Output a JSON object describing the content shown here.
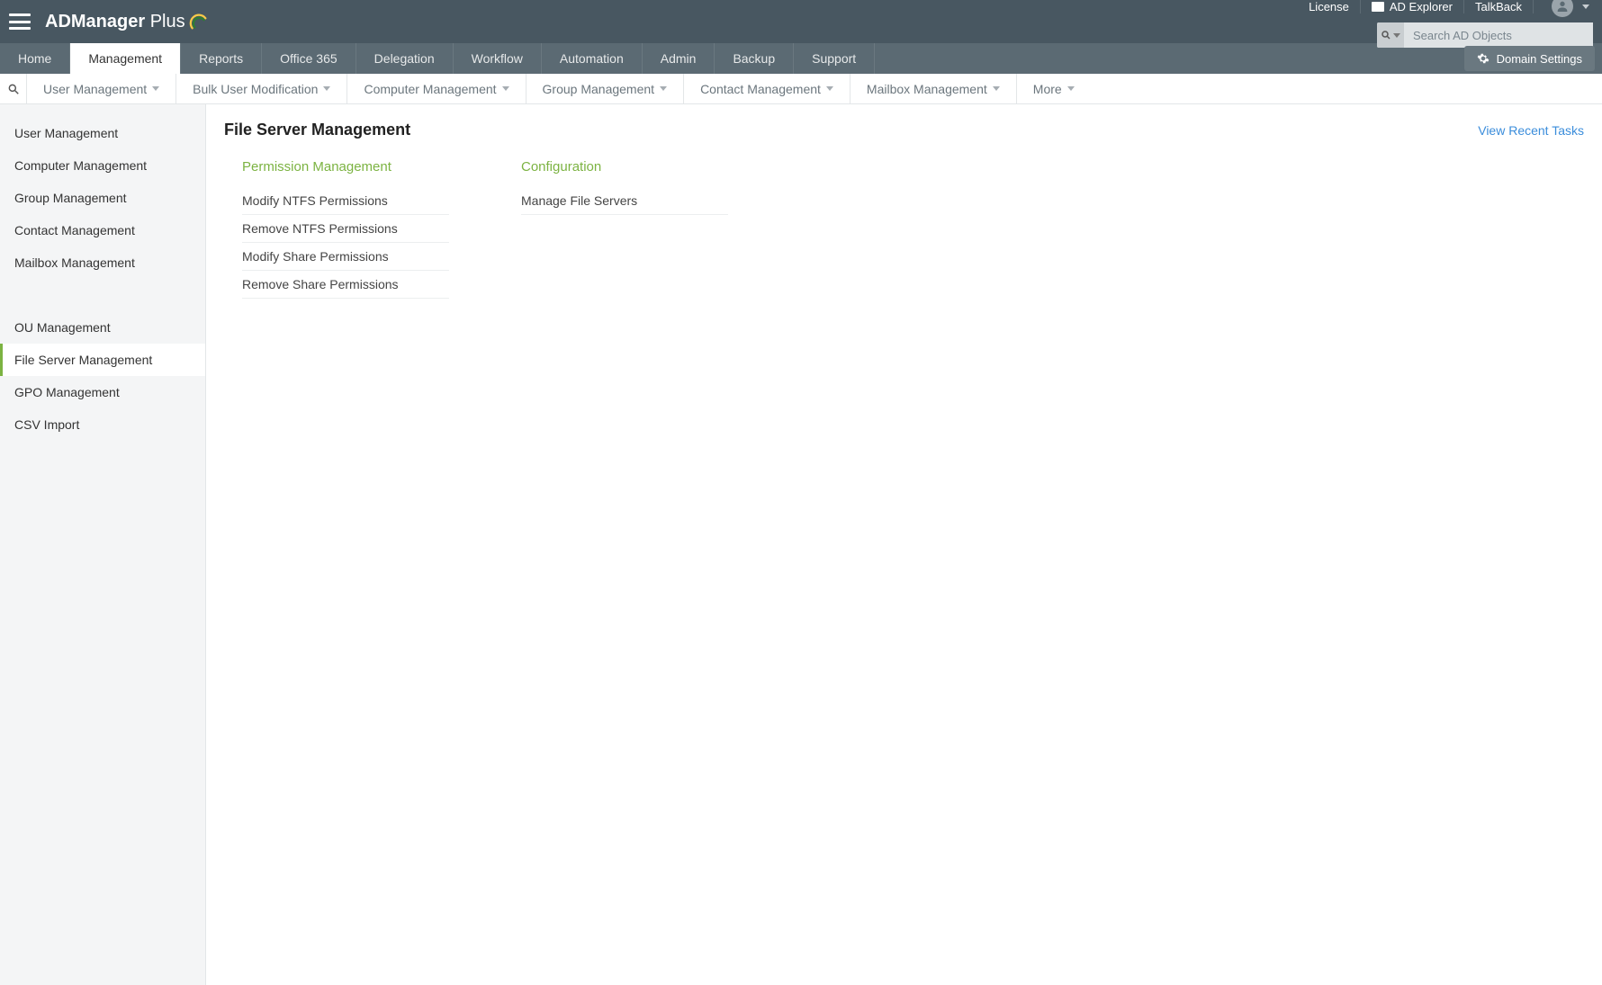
{
  "topbar": {
    "brand_bold": "ADManager",
    "brand_light": "Plus",
    "links": {
      "license": "License",
      "ad_explorer": "AD Explorer",
      "talkback": "TalkBack"
    },
    "search_placeholder": "Search AD Objects"
  },
  "nav": {
    "tabs": [
      "Home",
      "Management",
      "Reports",
      "Office 365",
      "Delegation",
      "Workflow",
      "Automation",
      "Admin",
      "Backup",
      "Support"
    ],
    "active": "Management",
    "domain_settings": "Domain Settings"
  },
  "subnav": {
    "items": [
      "User Management",
      "Bulk User Modification",
      "Computer Management",
      "Group Management",
      "Contact Management",
      "Mailbox Management",
      "More"
    ]
  },
  "sidebar": {
    "group1": [
      "User Management",
      "Computer Management",
      "Group Management",
      "Contact Management",
      "Mailbox Management"
    ],
    "group2": [
      "OU Management",
      "File Server Management",
      "GPO Management",
      "CSV Import"
    ],
    "active": "File Server Management"
  },
  "content": {
    "title": "File Server Management",
    "view_recent": "View Recent Tasks",
    "sections": [
      {
        "title": "Permission Management",
        "links": [
          "Modify NTFS Permissions",
          "Remove NTFS Permissions",
          "Modify Share Permissions",
          "Remove Share Permissions"
        ]
      },
      {
        "title": "Configuration",
        "links": [
          "Manage File Servers"
        ]
      }
    ]
  }
}
